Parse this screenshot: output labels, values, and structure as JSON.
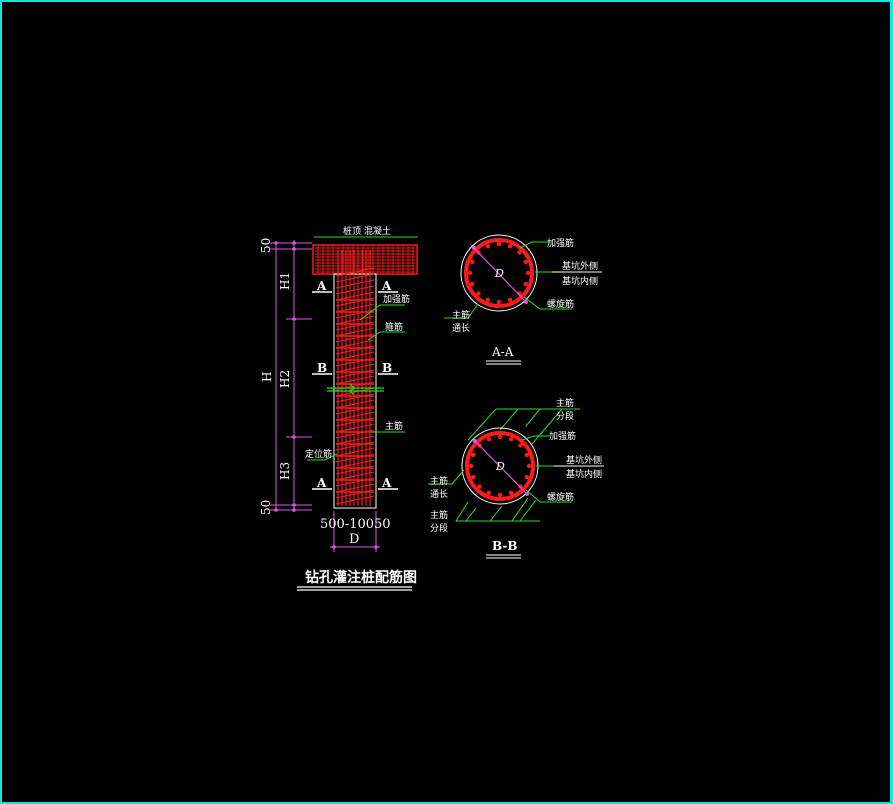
{
  "drawing": {
    "title": "钻孔灌注桩配筋图",
    "colors": {
      "frame": "#12e4e4",
      "rebar": "#ff1a1a",
      "leader": "#22e022",
      "dimension": "#e055e6",
      "text": "#ffffff"
    },
    "elevation": {
      "top_label": "桩顶 混凝土",
      "dims": {
        "top": "50",
        "bottom": "50",
        "h1": "H1",
        "h2": "H2",
        "h3": "H3",
        "h": "H"
      },
      "section_marks": {
        "a": "A",
        "b": "B"
      },
      "labels": {
        "strengthen": "加强筋",
        "stirrup": "箍筋",
        "main": "主筋",
        "locator": "定位筋"
      },
      "spacing": "500-10050",
      "diameter": "D"
    },
    "section_aa": {
      "title": "A-A",
      "diameter": "D",
      "labels": {
        "strengthen": "加强筋",
        "outer": "基坑外侧",
        "inner": "基坑内侧",
        "spiral": "螺旋筋",
        "main": "主筋",
        "through": "通长"
      }
    },
    "section_bb": {
      "title": "B-B",
      "diameter": "D",
      "labels": {
        "main_top": "主筋",
        "split_top": "分段",
        "strengthen": "加强筋",
        "outer": "基坑外侧",
        "inner": "基坑内侧",
        "spiral": "螺旋筋",
        "main_left": "主筋",
        "through": "通长",
        "main_bottom": "主筋",
        "split_bottom": "分段"
      }
    }
  }
}
